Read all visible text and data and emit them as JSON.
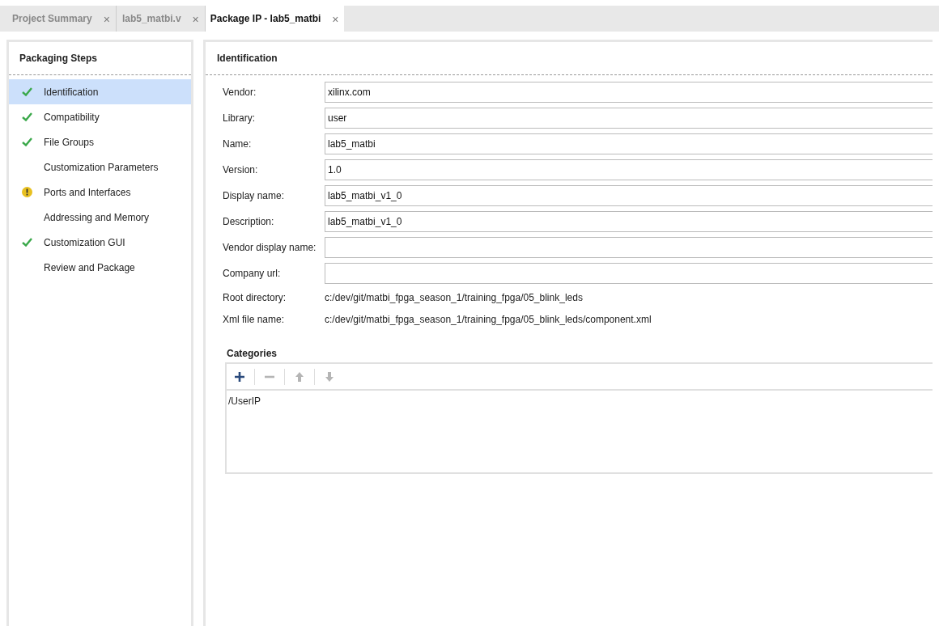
{
  "tabs": [
    {
      "label": "Project Summary",
      "selected": false,
      "close": "×"
    },
    {
      "label": "lab5_matbi.v",
      "selected": false,
      "close": "×"
    },
    {
      "label": "Package IP - lab5_matbi",
      "selected": true,
      "close": "×"
    }
  ],
  "steps_panel": {
    "title": "Packaging Steps",
    "items": [
      {
        "label": "Identification",
        "kind": "check",
        "selected": true
      },
      {
        "label": "Compatibility",
        "kind": "check",
        "selected": false
      },
      {
        "label": "File Groups",
        "kind": "check",
        "selected": false
      },
      {
        "label": "Customization Parameters",
        "kind": "plain",
        "selected": false
      },
      {
        "label": "Ports and Interfaces",
        "kind": "warning",
        "selected": false
      },
      {
        "label": "Addressing and Memory",
        "kind": "plain",
        "selected": false
      },
      {
        "label": "Customization GUI",
        "kind": "check",
        "selected": false
      },
      {
        "label": "Review and Package",
        "kind": "plain",
        "selected": false
      }
    ]
  },
  "identification": {
    "title": "Identification",
    "fields": [
      {
        "kind": "input",
        "label": "Vendor:",
        "value": "xilinx.com"
      },
      {
        "kind": "input",
        "label": "Library:",
        "value": "user"
      },
      {
        "kind": "input",
        "label": "Name:",
        "value": "lab5_matbi"
      },
      {
        "kind": "input",
        "label": "Version:",
        "value": "1.0"
      },
      {
        "kind": "input",
        "label": "Display name:",
        "value": "lab5_matbi_v1_0"
      },
      {
        "kind": "input",
        "label": "Description:",
        "value": "lab5_matbi_v1_0"
      },
      {
        "kind": "input",
        "label": "Vendor display name:"
      },
      {
        "kind": "input",
        "label": "Company url:"
      },
      {
        "kind": "text",
        "label": "Root directory:",
        "value": "c:/dev/git/matbi_fpga_season_1/training_fpga/05_blink_leds"
      },
      {
        "kind": "text",
        "label": "Xml file name:",
        "value": "c:/dev/git/matbi_fpga_season_1/training_fpga/05_blink_leds/component.xml"
      }
    ],
    "categories": {
      "title": "Categories",
      "toolbar": [
        {
          "kind": "add",
          "disabled": false
        },
        {
          "kind": "remove",
          "disabled": true
        },
        {
          "kind": "up",
          "disabled": true
        },
        {
          "kind": "down",
          "disabled": true
        }
      ],
      "items": [
        "/UserIP"
      ]
    }
  }
}
